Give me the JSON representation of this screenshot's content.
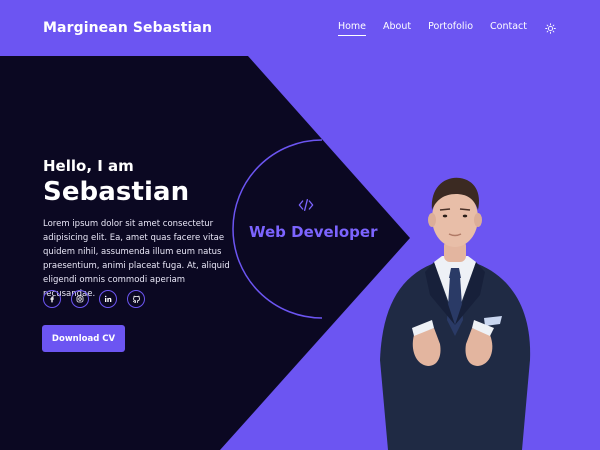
{
  "brand": {
    "name": "Marginean Sebastian"
  },
  "nav": {
    "items": [
      {
        "label": "Home",
        "active": true
      },
      {
        "label": "About",
        "active": false
      },
      {
        "label": "Portofolio",
        "active": false
      },
      {
        "label": "Contact",
        "active": false
      }
    ],
    "theme_icon": "sun-icon"
  },
  "hero": {
    "greeting": "Hello, I am",
    "name": "Sebastian",
    "description": "Lorem ipsum dolor sit amet consectetur adipisicing elit. Ea, amet quas facere vitae quidem nihil, assumenda illum eum natus praesentium, animi placeat fuga. At, aliquid eligendi omnis commodi aperiam recusandae.",
    "role": "Web Developer",
    "role_icon": "code-icon",
    "cta_label": "Download CV"
  },
  "socials": [
    {
      "icon": "facebook-icon"
    },
    {
      "icon": "instagram-icon"
    },
    {
      "icon": "linkedin-icon"
    },
    {
      "icon": "github-icon"
    }
  ],
  "portrait": {
    "icon": "portrait-photo"
  },
  "colors": {
    "accent": "#6c55f2",
    "dark": "#0b0822",
    "role_text": "#7c64ff",
    "text": "#ffffff"
  }
}
